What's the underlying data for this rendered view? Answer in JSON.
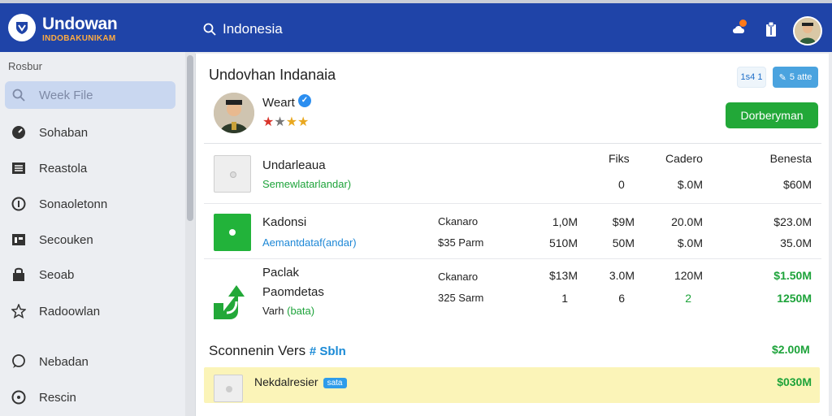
{
  "app": {
    "name": "Undowan",
    "subtitle": "INDOBAKUNIKAM"
  },
  "search": {
    "value": "Indonesia",
    "placeholder": "Indonesia"
  },
  "sidebar": {
    "heading": "Rosbur",
    "items": [
      {
        "label": "Week File",
        "icon": "search-icon",
        "active": true
      },
      {
        "label": "Sohaban",
        "icon": "gauge-icon"
      },
      {
        "label": "Reastola",
        "icon": "list-icon"
      },
      {
        "label": "Sonaoletonn",
        "icon": "info-icon"
      },
      {
        "label": "Secouken",
        "icon": "calendar-icon"
      },
      {
        "label": "Seoab",
        "icon": "lock-icon"
      },
      {
        "label": "Radoowlan",
        "icon": "star-icon"
      },
      {
        "label": "Nebadan",
        "icon": "chat-icon"
      },
      {
        "label": "Rescin",
        "icon": "info-circle-icon"
      }
    ]
  },
  "page": {
    "title": "Undovhan Indanaia",
    "vendor_name": "Weart",
    "rating": 3,
    "rating_max": 4,
    "btn_a": "1s4 1",
    "btn_b": "5 atte",
    "primary_button": "Dorberyman"
  },
  "table": {
    "headers": [
      "Fiks",
      "Cadero",
      "Benesta"
    ],
    "rows": [
      {
        "title": "Undarleaua",
        "subtitle": "Semewlatarlandar)",
        "c1": "",
        "c1b": "",
        "v1": "",
        "v1b": "",
        "v2": "0",
        "v2b": "",
        "v3": "$.0M",
        "v3b": "",
        "v4": "$60M",
        "v4b": ""
      },
      {
        "title": "Kadonsi",
        "subtitle": "Aemantdataf(andar)",
        "c1": "Ckanaro",
        "c1b": "$35 Parm",
        "v1": "1,0M",
        "v1b": "510M",
        "v2": "$9M",
        "v2b": "50M",
        "v3": "20.0M",
        "v3b": "$.0M",
        "v4": "$23.0M",
        "v4b": "35.0M"
      },
      {
        "title": "Paclak",
        "subtitle": "Paomdetas",
        "subtitle2": "Varh",
        "tag": "(bata)",
        "c1": "Ckanaro",
        "c1b": "325 Sarm",
        "v1": "$13M",
        "v1b": "1",
        "v2": "3.0M",
        "v2b": "6",
        "v3": "120M",
        "v3b": "2",
        "v4": "$1.50M",
        "v4b": "1250M"
      }
    ]
  },
  "section": {
    "title": "Sconnenin Vers",
    "tag": "# Sbln",
    "amount": "$2.00M"
  },
  "highlight": {
    "label": "Nekdalresier",
    "tag": "sata",
    "amount": "$030M"
  },
  "colors": {
    "topbar": "#1f44a8",
    "accent_green": "#22a838",
    "accent_blue": "#2b8ef0",
    "brand_orange": "#ffab40"
  }
}
